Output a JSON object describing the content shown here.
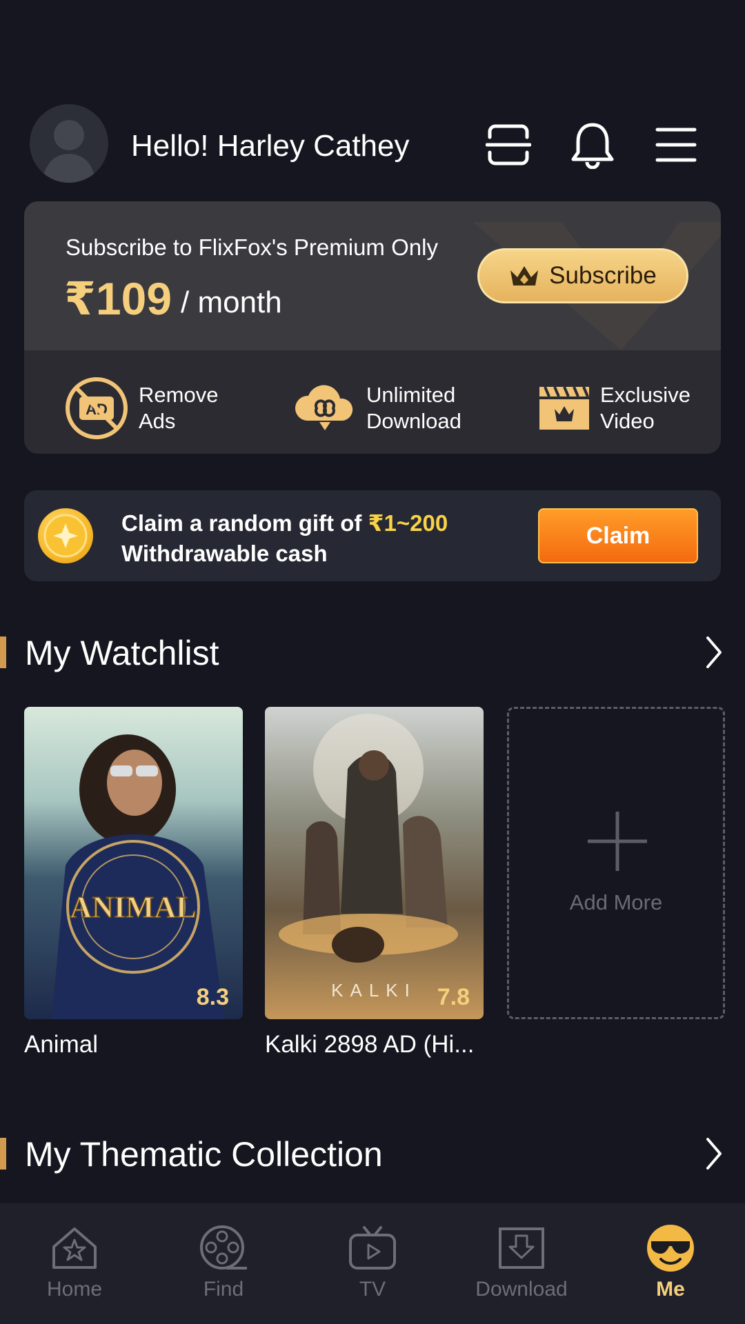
{
  "header": {
    "greeting": "Hello! Harley Cathey",
    "icons": [
      "scan-icon",
      "bell-icon",
      "menu-icon"
    ]
  },
  "premium": {
    "subtitle": "Subscribe to FlixFox's Premium Only",
    "price": "₹109",
    "period": "/ month",
    "subscribe_label": "Subscribe",
    "features": [
      {
        "line1": "Remove",
        "line2": "Ads",
        "icon": "no-ads-icon"
      },
      {
        "line1": "Unlimited",
        "line2": "Download",
        "icon": "cloud-download-icon"
      },
      {
        "line1": "Exclusive",
        "line2": "Video",
        "icon": "clapperboard-icon"
      }
    ],
    "accent": "#f6cf7d"
  },
  "claim": {
    "text_prefix": "Claim a random gift of ",
    "amount": "₹1~200",
    "text_line2": "Withdrawable cash",
    "button_label": "Claim"
  },
  "watchlist": {
    "title": "My Watchlist",
    "items": [
      {
        "title": "Animal",
        "rating": "8.3",
        "poster_text": "ANIMAL"
      },
      {
        "title": "Kalki 2898 AD (Hi...",
        "rating": "7.8",
        "poster_text": "KALKI"
      }
    ],
    "add_more_label": "Add More"
  },
  "thematic": {
    "title": "My Thematic Collection"
  },
  "nav": {
    "items": [
      {
        "label": "Home",
        "icon": "home-icon"
      },
      {
        "label": "Find",
        "icon": "film-reel-icon"
      },
      {
        "label": "TV",
        "icon": "tv-icon"
      },
      {
        "label": "Download",
        "icon": "download-icon"
      },
      {
        "label": "Me",
        "icon": "profile-emoji-icon"
      }
    ],
    "active": "Me"
  }
}
